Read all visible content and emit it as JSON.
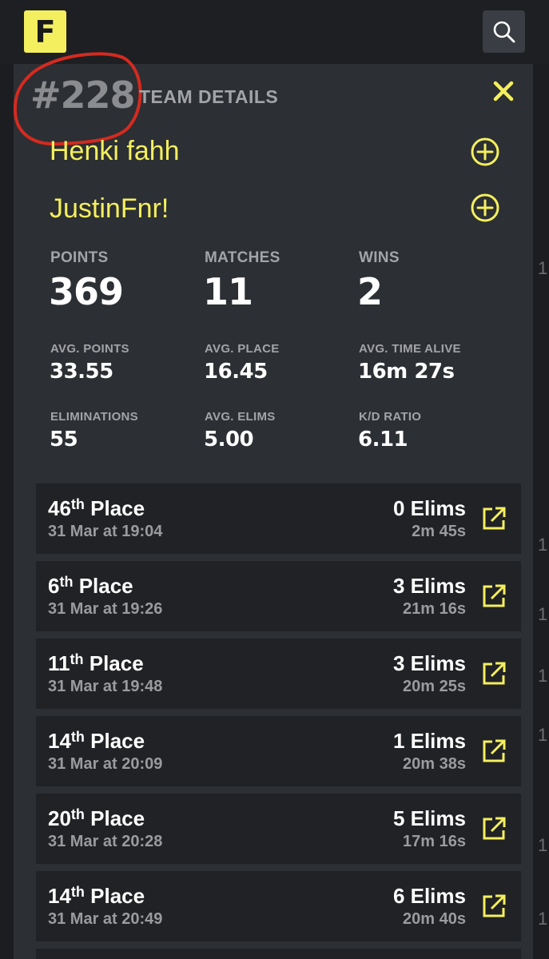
{
  "header": {
    "logo_letter": "F"
  },
  "edge_numbers": [
    "1",
    "1",
    "1",
    "1",
    "1",
    "1",
    "1",
    "1"
  ],
  "team": {
    "rank": "#228",
    "title": "TEAM DETAILS",
    "members": [
      "Henki fahh",
      "JustinFnr!"
    ]
  },
  "stats": {
    "points_label": "POINTS",
    "points": "369",
    "matches_label": "MATCHES",
    "matches": "11",
    "wins_label": "WINS",
    "wins": "2",
    "avg_points_label": "AVG. POINTS",
    "avg_points": "33.55",
    "avg_place_label": "AVG. PLACE",
    "avg_place": "16.45",
    "avg_time_alive_label": "AVG. TIME ALIVE",
    "avg_time_alive": "16m 27s",
    "eliminations_label": "ELIMINATIONS",
    "eliminations": "55",
    "avg_elims_label": "AVG. ELIMS",
    "avg_elims": "5.00",
    "kd_ratio_label": "K/D RATIO",
    "kd_ratio": "6.11"
  },
  "matches": [
    {
      "place": "46",
      "suffix": "th",
      "place_word": " Place",
      "date": "31 Mar at 19:04",
      "elims": "0 Elims",
      "time": "2m 45s"
    },
    {
      "place": "6",
      "suffix": "th",
      "place_word": " Place",
      "date": "31 Mar at 19:26",
      "elims": "3 Elims",
      "time": "21m 16s"
    },
    {
      "place": "11",
      "suffix": "th",
      "place_word": " Place",
      "date": "31 Mar at 19:48",
      "elims": "3 Elims",
      "time": "20m 25s"
    },
    {
      "place": "14",
      "suffix": "th",
      "place_word": " Place",
      "date": "31 Mar at 20:09",
      "elims": "1 Elims",
      "time": "20m 38s"
    },
    {
      "place": "20",
      "suffix": "th",
      "place_word": " Place",
      "date": "31 Mar at 20:28",
      "elims": "5 Elims",
      "time": "17m 16s"
    },
    {
      "place": "14",
      "suffix": "th",
      "place_word": " Place",
      "date": "31 Mar at 20:49",
      "elims": "6 Elims",
      "time": "20m 40s"
    }
  ],
  "colors": {
    "accent": "#f4ef5f",
    "panel": "#2c2f33",
    "row": "#212225",
    "annotation": "#d42a20"
  },
  "icons": {
    "search": "search-icon",
    "close": "close-icon",
    "add": "plus-circle-icon",
    "open": "external-link-icon"
  }
}
